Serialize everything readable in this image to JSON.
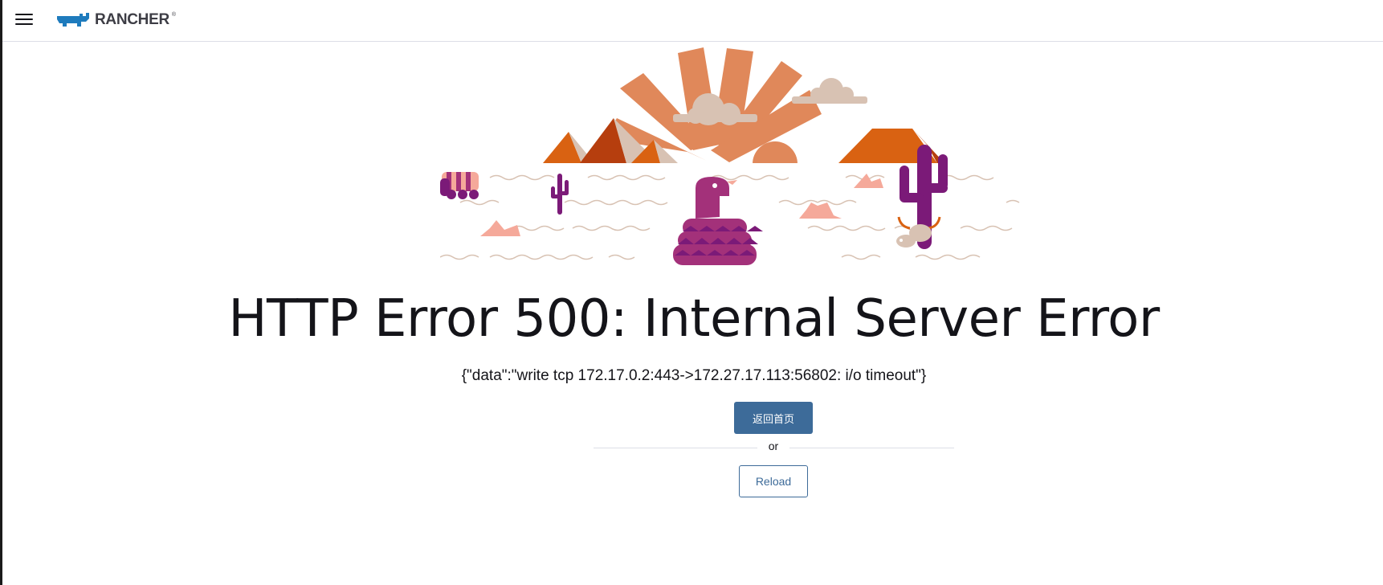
{
  "header": {
    "menu_icon": "hamburger-menu-icon",
    "brand_icon": "rancher-bull-logo-icon",
    "brand_name": "RANCHER",
    "brand_mark": "®"
  },
  "error": {
    "title": "HTTP Error 500: Internal Server Error",
    "detail": "{\"data\":\"write tcp 172.17.0.2:443->172.27.17.113:56802: i/o timeout\"}"
  },
  "actions": {
    "home_label": "返回首页",
    "or_label": "or",
    "reload_label": "Reload"
  },
  "colors": {
    "primary": "#3d6b99",
    "text": "#141419",
    "orange": "#e0885a",
    "rust": "#d96212",
    "purple": "#7b1a78",
    "pink": "#f5a99a",
    "tan": "#d8c2b3"
  }
}
